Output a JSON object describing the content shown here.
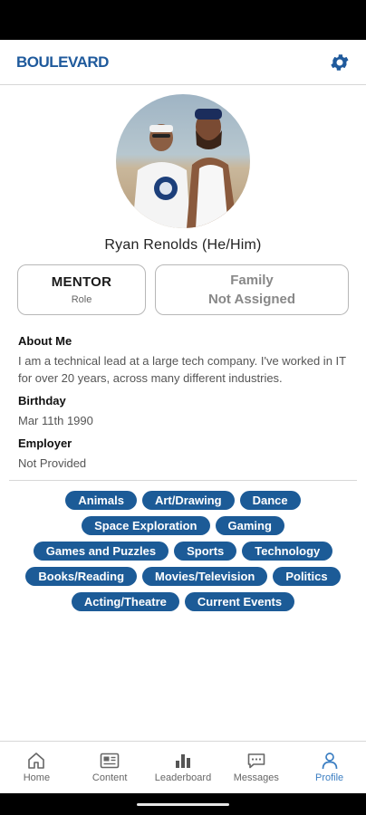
{
  "header": {
    "logo_text": "BOULEVARD",
    "settings_icon": "gear-icon"
  },
  "profile": {
    "name": "Ryan Renolds (He/Him)",
    "role_title": "MENTOR",
    "role_label": "Role",
    "family_line1": "Family",
    "family_line2": "Not Assigned"
  },
  "about": {
    "label": "About Me",
    "text": "I am a technical lead at a large tech company.  I've worked in IT for over 20 years, across many different industries."
  },
  "birthday": {
    "label": "Birthday",
    "value": "Mar 11th 1990"
  },
  "employer": {
    "label": "Employer",
    "value": "Not Provided"
  },
  "interests": [
    "Animals",
    "Art/Drawing",
    "Dance",
    "Space Exploration",
    "Gaming",
    "Games and Puzzles",
    "Sports",
    "Technology",
    "Books/Reading",
    "Movies/Television",
    "Politics",
    "Acting/Theatre",
    "Current Events"
  ],
  "nav": [
    {
      "label": "Home",
      "icon": "home-icon"
    },
    {
      "label": "Content",
      "icon": "content-icon"
    },
    {
      "label": "Leaderboard",
      "icon": "leaderboard-icon"
    },
    {
      "label": "Messages",
      "icon": "messages-icon"
    },
    {
      "label": "Profile",
      "icon": "profile-icon",
      "active": true
    }
  ],
  "colors": {
    "brand": "#1c5b97",
    "active_nav": "#3b7ec2"
  }
}
